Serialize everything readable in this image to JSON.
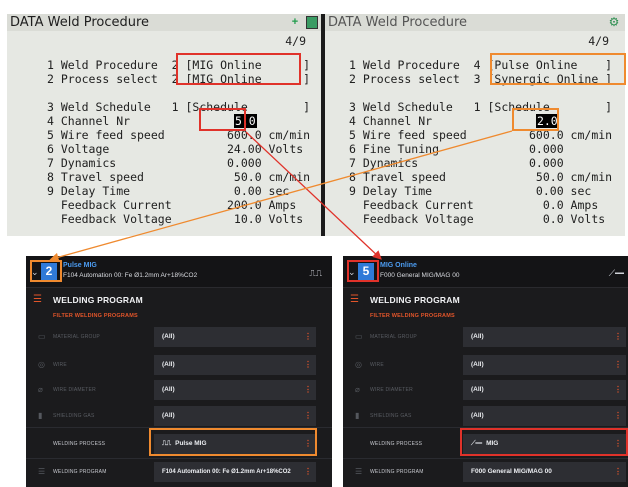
{
  "left_panel": {
    "title": "DATA Weld Procedure",
    "page": "4/9",
    "rows": [
      {
        "text": "1 Weld Procedure  2 [MIG Online      ]"
      },
      {
        "text": "2 Process select  2 [MIG Online      ]"
      },
      {
        "text": "3 Weld Schedule   1 [Schedule        ]"
      },
      {
        "prefix": "4 Channel Nr               ",
        "value": "5.0"
      },
      {
        "text": "5 Wire feed speed         600.0 cm/min"
      },
      {
        "text": "6 Voltage                 24.00 Volts"
      },
      {
        "text": "7 Dynamics                0.000"
      },
      {
        "text": "8 Travel speed             50.0 cm/min"
      },
      {
        "text": "9 Delay Time               0.00 sec"
      },
      {
        "text": "  Feedback Current        200.0 Amps"
      },
      {
        "text": "  Feedback Voltage         10.0 Volts"
      }
    ]
  },
  "right_panel": {
    "title": "DATA Weld Procedure",
    "page": "4/9",
    "rows": [
      {
        "text": "1 Weld Procedure  4 [Pulse Online    ]"
      },
      {
        "text": "2 Process select  3 [Synergic Online ]"
      },
      {
        "text": "3 Weld Schedule   1 [Schedule        ]"
      },
      {
        "prefix": "4 Channel Nr               ",
        "value": "2.0"
      },
      {
        "text": "5 Wire feed speed         600.0 cm/min"
      },
      {
        "text": "6 Fine Tuning             0.000"
      },
      {
        "text": "7 Dynamics                0.000"
      },
      {
        "text": "8 Travel speed             50.0 cm/min"
      },
      {
        "text": "9 Delay Time               0.00 sec"
      },
      {
        "text": "  Feedback Current          0.0 Amps"
      },
      {
        "text": "  Feedback Voltage          0.0 Volts"
      }
    ]
  },
  "wp_left": {
    "channel": "2",
    "program_name": "Pulse MIG",
    "program_sub": "F104 Automation 00: Fe Ø1.2mm Ar+18%CO2",
    "wave_icon": "pulse-wave-icon",
    "heading": "WELDING PROGRAM",
    "filter_title": "FILTER WELDING PROGRAMS",
    "fields": [
      {
        "label": "MATERIAL GROUP",
        "value": "(All)"
      },
      {
        "label": "WIRE",
        "value": "(All)"
      },
      {
        "label": "WIRE DIAMETER",
        "value": "(All)"
      },
      {
        "label": "SHIELDING GAS",
        "value": "(All)"
      },
      {
        "label": "WELDING PROCESS",
        "value": "Pulse MIG"
      },
      {
        "label": "WELDING PROGRAM",
        "value": "F104 Automation 00: Fe Ø1.2mm Ar+18%CO2"
      }
    ]
  },
  "wp_right": {
    "channel": "5",
    "program_name": "MIG Online",
    "program_sub": "F000 General MIG/MAG 00",
    "wave_icon": "mig-arc-icon",
    "heading": "WELDING PROGRAM",
    "filter_title": "FILTER WELDING PROGRAMS",
    "fields": [
      {
        "label": "MATERIAL GROUP",
        "value": "(All)"
      },
      {
        "label": "WIRE",
        "value": "(All)"
      },
      {
        "label": "WIRE DIAMETER",
        "value": "(All)"
      },
      {
        "label": "SHIELDING GAS",
        "value": "(All)"
      },
      {
        "label": "WELDING PROCESS",
        "value": "MIG"
      },
      {
        "label": "WELDING PROGRAM",
        "value": "F000 General MIG/MAG 00"
      }
    ]
  },
  "colors": {
    "annotation_red": "#e0322a",
    "annotation_orange": "#ef8a2f",
    "accent": "#e2552a",
    "channel_badge": "#2f7ad8"
  }
}
